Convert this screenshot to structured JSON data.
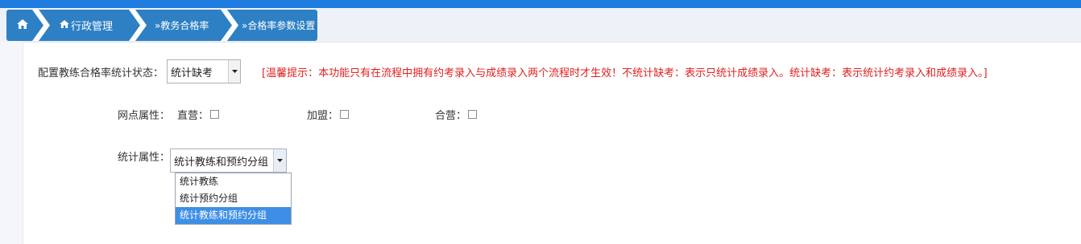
{
  "breadcrumb": {
    "home_icon": "home-icon",
    "items": [
      {
        "label": "行政管理",
        "icon": "home-icon"
      },
      {
        "label": "»教务合格率"
      },
      {
        "label": "»合格率参数设置"
      }
    ]
  },
  "config": {
    "label": "配置教练合格率统计状态：",
    "selected": "统计缺考",
    "tip": "[温馨提示：本功能只有在流程中拥有约考录入与成绩录入两个流程时才生效！不统计缺考：表示只统计成绩录入。统计缺考：表示统计约考录入和成绩录入。]"
  },
  "branch": {
    "label": "网点属性：",
    "options": [
      {
        "label": "直营：",
        "checked": false
      },
      {
        "label": "加盟：",
        "checked": false
      },
      {
        "label": "合营：",
        "checked": false
      }
    ]
  },
  "stat": {
    "label": "统计属性：",
    "selected": "统计教练和预约分组",
    "options": [
      "统计教练",
      "统计预约分组",
      "统计教练和预约分组"
    ]
  },
  "colors": {
    "accent": "#2d80c4",
    "topbar": "#1f7de0",
    "tip": "#e02020",
    "highlight": "#3d8ee6"
  }
}
